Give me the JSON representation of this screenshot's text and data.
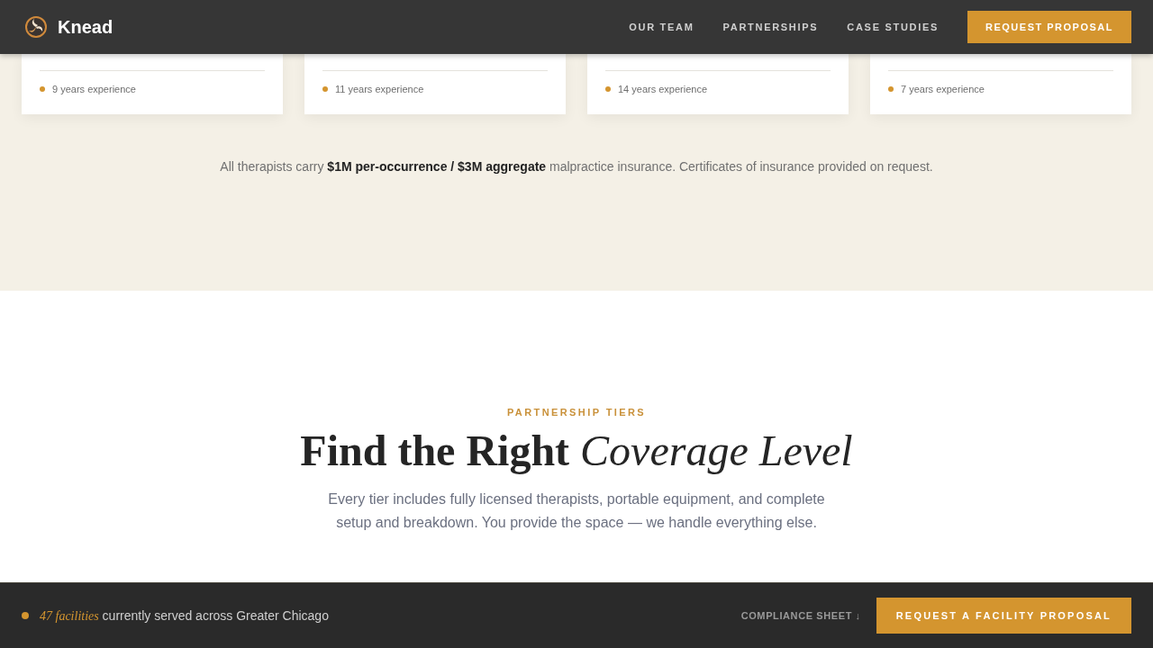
{
  "header": {
    "brand": "Knead",
    "nav": [
      {
        "label": "OUR TEAM"
      },
      {
        "label": "PARTNERSHIPS"
      },
      {
        "label": "CASE STUDIES"
      }
    ],
    "cta": "REQUEST PROPOSAL"
  },
  "team_cards": [
    {
      "experience": "9 years experience"
    },
    {
      "experience": "11 years experience"
    },
    {
      "experience": "14 years experience"
    },
    {
      "experience": "7 years experience"
    }
  ],
  "insurance_note": "All therapists carry **$1M per-occurrence / $3M aggregate** malpractice insurance. Certificates of insurance provided on request.",
  "tiers_section": {
    "eyebrow": "PARTNERSHIP TIERS",
    "heading": "Find the Right *Coverage Level*",
    "description": "Every tier includes fully licensed therapists, portable equipment, and complete setup and breakdown. You provide the space — we handle everything else."
  },
  "footer_bar": {
    "status": "*47 facilities* currently served across Greater Chicago",
    "link": "COMPLIANCE SHEET ↓",
    "cta": "REQUEST A FACILITY PROPOSAL"
  }
}
